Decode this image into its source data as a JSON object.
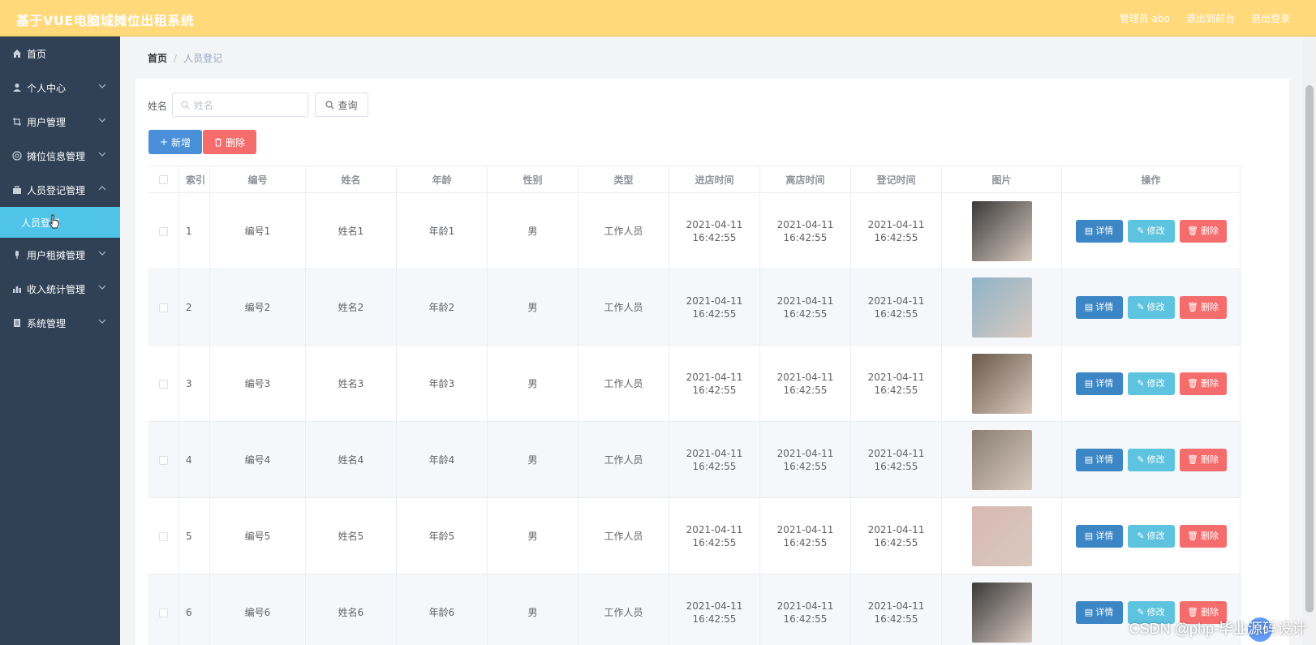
{
  "app": {
    "title": "基于VUE电脑城摊位出租系统"
  },
  "topnav": {
    "admin": "管理员 abo",
    "front": "退出到前台",
    "logout": "退出登录"
  },
  "sidebar": {
    "items": [
      {
        "label": "首页",
        "icon": "home-icon"
      },
      {
        "label": "个人中心",
        "icon": "user-icon"
      },
      {
        "label": "用户管理",
        "icon": "crop-icon"
      },
      {
        "label": "摊位信息管理",
        "icon": "globe-icon"
      },
      {
        "label": "人员登记管理",
        "icon": "briefcase-icon"
      },
      {
        "label": "用户租摊管理",
        "icon": "mic-icon"
      },
      {
        "label": "收入统计管理",
        "icon": "chart-icon"
      },
      {
        "label": "系统管理",
        "icon": "file-icon"
      }
    ],
    "submenu": "人员登记"
  },
  "breadcrumb": {
    "home": "首页",
    "sep": "/",
    "current": "人员登记"
  },
  "search": {
    "label": "姓名",
    "placeholder": "姓名",
    "query_button": "查询"
  },
  "actions": {
    "add": "新增",
    "delete": "删除"
  },
  "table": {
    "headers": [
      "",
      "索引",
      "编号",
      "姓名",
      "年龄",
      "性别",
      "类型",
      "进店时间",
      "离店时间",
      "登记时间",
      "图片",
      "操作"
    ],
    "row_buttons": {
      "detail": "详情",
      "edit": "修改",
      "delete": "删除"
    },
    "rows": [
      {
        "index": "1",
        "code": "编号1",
        "name": "姓名1",
        "age": "年龄1",
        "gender": "男",
        "type": "工作人员",
        "in_time": "2021-04-11 16:42:55",
        "out_time": "2021-04-11 16:42:55",
        "reg_time": "2021-04-11 16:42:55",
        "photo_color": "#3a3a3a"
      },
      {
        "index": "2",
        "code": "编号2",
        "name": "姓名2",
        "age": "年龄2",
        "gender": "男",
        "type": "工作人员",
        "in_time": "2021-04-11 16:42:55",
        "out_time": "2021-04-11 16:42:55",
        "reg_time": "2021-04-11 16:42:55",
        "photo_color": "#8fb3c9"
      },
      {
        "index": "3",
        "code": "编号3",
        "name": "姓名3",
        "age": "年龄3",
        "gender": "男",
        "type": "工作人员",
        "in_time": "2021-04-11 16:42:55",
        "out_time": "2021-04-11 16:42:55",
        "reg_time": "2021-04-11 16:42:55",
        "photo_color": "#6b5a4a"
      },
      {
        "index": "4",
        "code": "编号4",
        "name": "姓名4",
        "age": "年龄4",
        "gender": "男",
        "type": "工作人员",
        "in_time": "2021-04-11 16:42:55",
        "out_time": "2021-04-11 16:42:55",
        "reg_time": "2021-04-11 16:42:55",
        "photo_color": "#8a7e72"
      },
      {
        "index": "5",
        "code": "编号5",
        "name": "姓名5",
        "age": "年龄5",
        "gender": "男",
        "type": "工作人员",
        "in_time": "2021-04-11 16:42:55",
        "out_time": "2021-04-11 16:42:55",
        "reg_time": "2021-04-11 16:42:55",
        "photo_color": "#d9b8b3"
      },
      {
        "index": "6",
        "code": "编号6",
        "name": "姓名6",
        "age": "年龄6",
        "gender": "男",
        "type": "工作人员",
        "in_time": "2021-04-11 16:42:55",
        "out_time": "2021-04-11 16:42:55",
        "reg_time": "2021-04-11 16:42:55",
        "photo_color": "#3a3a3a"
      }
    ]
  },
  "watermark": "CSDN @php-毕业源码设计",
  "colors": {
    "topbar": "#ffd97a",
    "sidebar": "#304156",
    "active_sub": "#4fc3e8",
    "primary": "#4a90d9",
    "danger": "#f56c6c",
    "info": "#5ec3de"
  }
}
